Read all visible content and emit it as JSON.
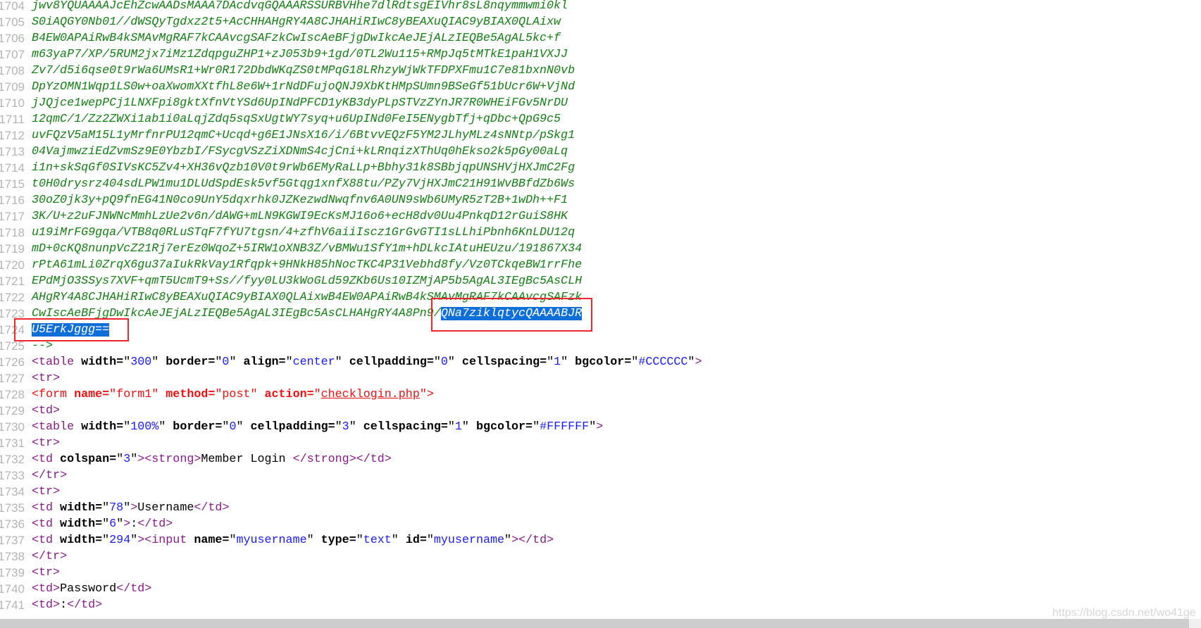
{
  "editor": {
    "lines": [
      {
        "n": "1704",
        "kind": "b64",
        "text": "jwv8YQUAAAAJcEhZcwAADsMAAA7DAcdvqGQAAARSSURBVHhe7dlRdtsgEIVhr8sL8nqymmwmi0kl"
      },
      {
        "n": "1705",
        "kind": "b64",
        "text": "S0iAQGY0Nb01//dWSQyTgdxz2t5+AcCHHAHgRY4A8CJHAHiRIwC8yBEAXuQIAC9yBIAX0QLAixw"
      },
      {
        "n": "1706",
        "kind": "b64",
        "text": "B4EW0APAiRwB4kSMAvMgRAF7kCAAvcgSAFzkCwIscAeBFjgDwIkcAeJEjALzIEQBe5AgAL5kc+f"
      },
      {
        "n": "1707",
        "kind": "b64",
        "text": "m63yaP7/XP/5RUM2jx7iMz1ZdqpguZHP1+zJ053b9+1gd/0TL2Wu115+RMpJq5tMTkE1paH1VXJJ"
      },
      {
        "n": "1708",
        "kind": "b64",
        "text": "Zv7/d5i6qse0t9rWa6UMsR1+Wr0R172DbdWKqZS0tMPqG18LRhzyWjWkTFDPXFmu1C7e81bxnN0vb"
      },
      {
        "n": "1709",
        "kind": "b64",
        "text": "DpYzOMN1Wqp1LS0w+oaXwomXXtfhL8e6W+1rNdDFujoQNJ9XbKtHMpSUmn9BSeGf51bUcr6W+VjNd"
      },
      {
        "n": "1710",
        "kind": "b64",
        "text": "jJQjce1wepPCj1LNXFpi8gktXfnVtYSd6UpINdPFCD1yKB3dyPLpSTVzZYnJR7R0WHEiFGv5NrDU"
      },
      {
        "n": "1711",
        "kind": "b64",
        "text": "12qmC/1/Zz2ZWXi1ab1i0aLqjZdq5sqSxUgtWY7syq+u6UpINd0FeI5ENygbTfj+qDbc+QpG9c5"
      },
      {
        "n": "1712",
        "kind": "b64",
        "text": "uvFQzV5aM15L1yMrfnrPU12qmC+Ucqd+g6E1JNsX16/i/6BtvvEQzF5YM2JLhyMLz4sNNtp/pSkg1"
      },
      {
        "n": "1713",
        "kind": "b64",
        "text": "04VajmwziEdZvmSz9E0YbzbI/FSycgVSzZiXDNmS4cjCni+kLRnqizXThUq0hEkso2k5pGy00aLq"
      },
      {
        "n": "1714",
        "kind": "b64",
        "text": "i1n+skSqGf0SIVsKC5Zv4+XH36vQzb10V0t9rWb6EMyRaLLp+Bbhy31k8SBbjqpUNSHVjHXJmC2Fg"
      },
      {
        "n": "1715",
        "kind": "b64",
        "text": "t0H0drysrz404sdLPW1mu1DLUdSpdEsk5vf5Gtqg1xnfX88tu/PZy7VjHXJmC21H91WvBBfdZb6Ws"
      },
      {
        "n": "1716",
        "kind": "b64",
        "text": "30oZ0jk3y+pQ9fnEG41N0co9UnY5dqxrhk0JZKezwdNwqfnv6A0UN9sWb6UMyR5zT2B+1wDh++F1"
      },
      {
        "n": "1717",
        "kind": "b64",
        "text": "3K/U+z2uFJNWNcMmhLzUe2v6n/dAWG+mLN9KGWI9EcKsMJ16o6+ecH8dv0Uu4PnkqD12rGuiS8HK"
      },
      {
        "n": "1718",
        "kind": "b64",
        "text": "u19iMrFG9gqa/VTB8q0RLuSTqF7fYU7tgsn/4+zfhV6aiiIscz1GrGvGTI1sLLhiPbnh6KnLDU12q"
      },
      {
        "n": "1719",
        "kind": "b64",
        "text": "mD+0cKQ8nunpVcZ21Rj7erEz0WqoZ+5IRW1oXNB3Z/vBMWu1SfY1m+hDLkcIAtuHEUzu/191867X34"
      },
      {
        "n": "1720",
        "kind": "b64",
        "text": "rPtA61mLi0ZrqX6gu37aIukRkVay1Rfqpk+9HNkH85hNocTKC4P31Vebhd8fy/Vz0TCkqeBW1rrFhe"
      },
      {
        "n": "1721",
        "kind": "b64",
        "text": "EPdMjO3SSys7XVF+qmT5UcmT9+Ss//fyy0LU3kWoGLd59ZKb6Us10IZMjAP5b5AgAL3IEgBc5AsCLH"
      },
      {
        "n": "1722",
        "kind": "b64",
        "text": "AHgRY4A8CJHAHiRIwC8yBEAXuQIAC9yBIAX0QLAixwB4EW0APAiRwB4kSMAvMgRAF7kCAAvcgSAFzk"
      },
      {
        "n": "1723",
        "kind": "b64",
        "text": "CwIscAeBFjgDwIkcAeJEjALzIEQBe5AgAL3IEgBc5AsCLHAHgRY4A8Pn9/",
        "selected": "QNa7ziklqtycQAAAABJR"
      },
      {
        "n": "1724",
        "kind": "b64",
        "text": "",
        "selected": "U5ErkJggg=="
      },
      {
        "n": "1725",
        "kind": "b64",
        "text": "-->"
      },
      {
        "n": "1726",
        "kind": "html",
        "text": "<table width=\"300\" border=\"0\" align=\"center\" cellpadding=\"0\" cellspacing=\"1\" bgcolor=\"#CCCCCC\">"
      },
      {
        "n": "1727",
        "kind": "html",
        "text": "<tr>"
      },
      {
        "n": "1728",
        "kind": "form",
        "text": "<form name=\"form1\" method=\"post\" action=\"checklogin.php\">",
        "underlined": "checklogin.php"
      },
      {
        "n": "1729",
        "kind": "html",
        "text": "<td>"
      },
      {
        "n": "1730",
        "kind": "html",
        "text": "<table width=\"100%\" border=\"0\" cellpadding=\"3\" cellspacing=\"1\" bgcolor=\"#FFFFFF\">"
      },
      {
        "n": "1731",
        "kind": "html",
        "text": "<tr>"
      },
      {
        "n": "1732",
        "kind": "html",
        "text": "<td colspan=\"3\"><strong>Member Login </strong></td>"
      },
      {
        "n": "1733",
        "kind": "html",
        "text": "</tr>"
      },
      {
        "n": "1734",
        "kind": "html",
        "text": "<tr>"
      },
      {
        "n": "1735",
        "kind": "html",
        "text": "<td width=\"78\">Username</td>"
      },
      {
        "n": "1736",
        "kind": "html",
        "text": "<td width=\"6\">:</td>"
      },
      {
        "n": "1737",
        "kind": "html",
        "text": "<td width=\"294\"><input name=\"myusername\" type=\"text\" id=\"myusername\"></td>"
      },
      {
        "n": "1738",
        "kind": "html",
        "text": "</tr>"
      },
      {
        "n": "1739",
        "kind": "html",
        "text": "<tr>"
      },
      {
        "n": "1740",
        "kind": "html",
        "text": "<td>Password</td>"
      },
      {
        "n": "1741",
        "kind": "html",
        "text": "<td>:</td>"
      }
    ]
  },
  "colors": {
    "base64": "#128012",
    "tag": "#8a1a8a",
    "value": "#1a1aff",
    "form_line": "#f01010",
    "selection": "#0f6fd8",
    "annotation_box": "#f0262c"
  },
  "watermark": "https://blog.csdn.net/wo41ge"
}
